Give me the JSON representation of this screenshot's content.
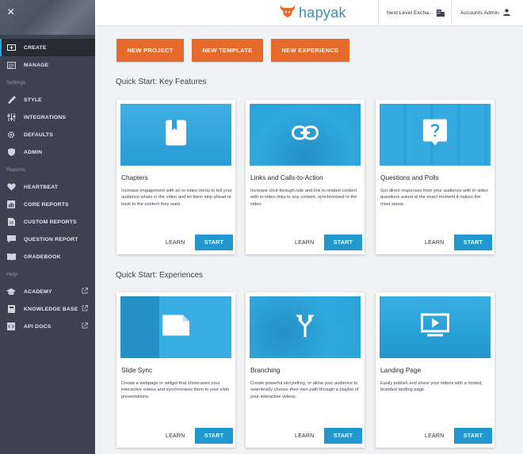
{
  "sidebar": {
    "close_label": "×",
    "items": [
      {
        "label": "CREATE",
        "icon": "create-icon"
      },
      {
        "label": "MANAGE",
        "icon": "manage-icon"
      },
      {
        "section": "Settings"
      },
      {
        "label": "STYLE",
        "icon": "brush-icon"
      },
      {
        "label": "INTEGRATIONS",
        "icon": "sliders-icon"
      },
      {
        "label": "DEFAULTS",
        "icon": "gear-icon"
      },
      {
        "label": "ADMIN",
        "icon": "shield-icon"
      },
      {
        "section": "Reports"
      },
      {
        "label": "HEARTBEAT",
        "icon": "heart-icon"
      },
      {
        "label": "CORE REPORTS",
        "icon": "bar-chart-icon"
      },
      {
        "label": "CUSTOM REPORTS",
        "icon": "document-icon"
      },
      {
        "label": "QUESTION REPORT",
        "icon": "chat-icon"
      },
      {
        "label": "GRADEBOOK",
        "icon": "book-icon"
      },
      {
        "section": "Help"
      },
      {
        "label": "ACADEMY",
        "icon": "graduation-cap-icon",
        "external": true
      },
      {
        "label": "KNOWLEDGE BASE",
        "icon": "notebook-icon",
        "external": true
      },
      {
        "label": "API DOCS",
        "icon": "code-icon",
        "external": true
      }
    ]
  },
  "header": {
    "logo_text": "hapyak",
    "account": "Next Level Excha...",
    "user": "Accounts Admin"
  },
  "actions": {
    "new_project": "NEW PROJECT",
    "new_template": "NEW TEMPLATE",
    "new_experience": "NEW EXPERIENCE"
  },
  "sections": {
    "features": "Quick Start: Key Features",
    "experiences": "Quick Start: Experiences"
  },
  "cards": [
    {
      "title": "Chapters",
      "desc": "Increase engagement with an in-video menu to tell your audience whats in the video and let them skip ahead or back to the content they want.",
      "learn": "LEARN",
      "start": "START",
      "icon": "bookmark-icon"
    },
    {
      "title": "Links and Calls-to-Action",
      "desc": "Increase click-through-rate and link to related content with in-video links to any content, synchronized to the video.",
      "learn": "LEARN",
      "start": "START",
      "icon": "link-icon"
    },
    {
      "title": "Questions and Polls",
      "desc": "Get direct responses from your audience with in-video questions asked at the exact moment it makes the most sense.",
      "learn": "LEARN",
      "start": "START",
      "icon": "question-icon"
    },
    {
      "title": "Slide Sync",
      "desc": "Create a webpage or widget that showcases your interactive videos and synchronizes them to your slide presentations.",
      "learn": "LEARN",
      "start": "START",
      "icon": "slide-icon"
    },
    {
      "title": "Branching",
      "desc": "Create powerful storytelling, or allow your audience to seamlessly choose their own path through a playlist of your interactive videos.",
      "learn": "LEARN",
      "start": "START",
      "icon": "branch-icon"
    },
    {
      "title": "Landing Page",
      "desc": "Easily publish and share your videos with a hosted, branded landing page.",
      "learn": "LEARN",
      "start": "START",
      "icon": "video-play-icon"
    }
  ],
  "colors": {
    "sidebar_bg": "#3b4252",
    "accent_blue": "#2197d0",
    "accent_orange": "#e56a2c",
    "thumb_blue": "#29a4dc"
  }
}
